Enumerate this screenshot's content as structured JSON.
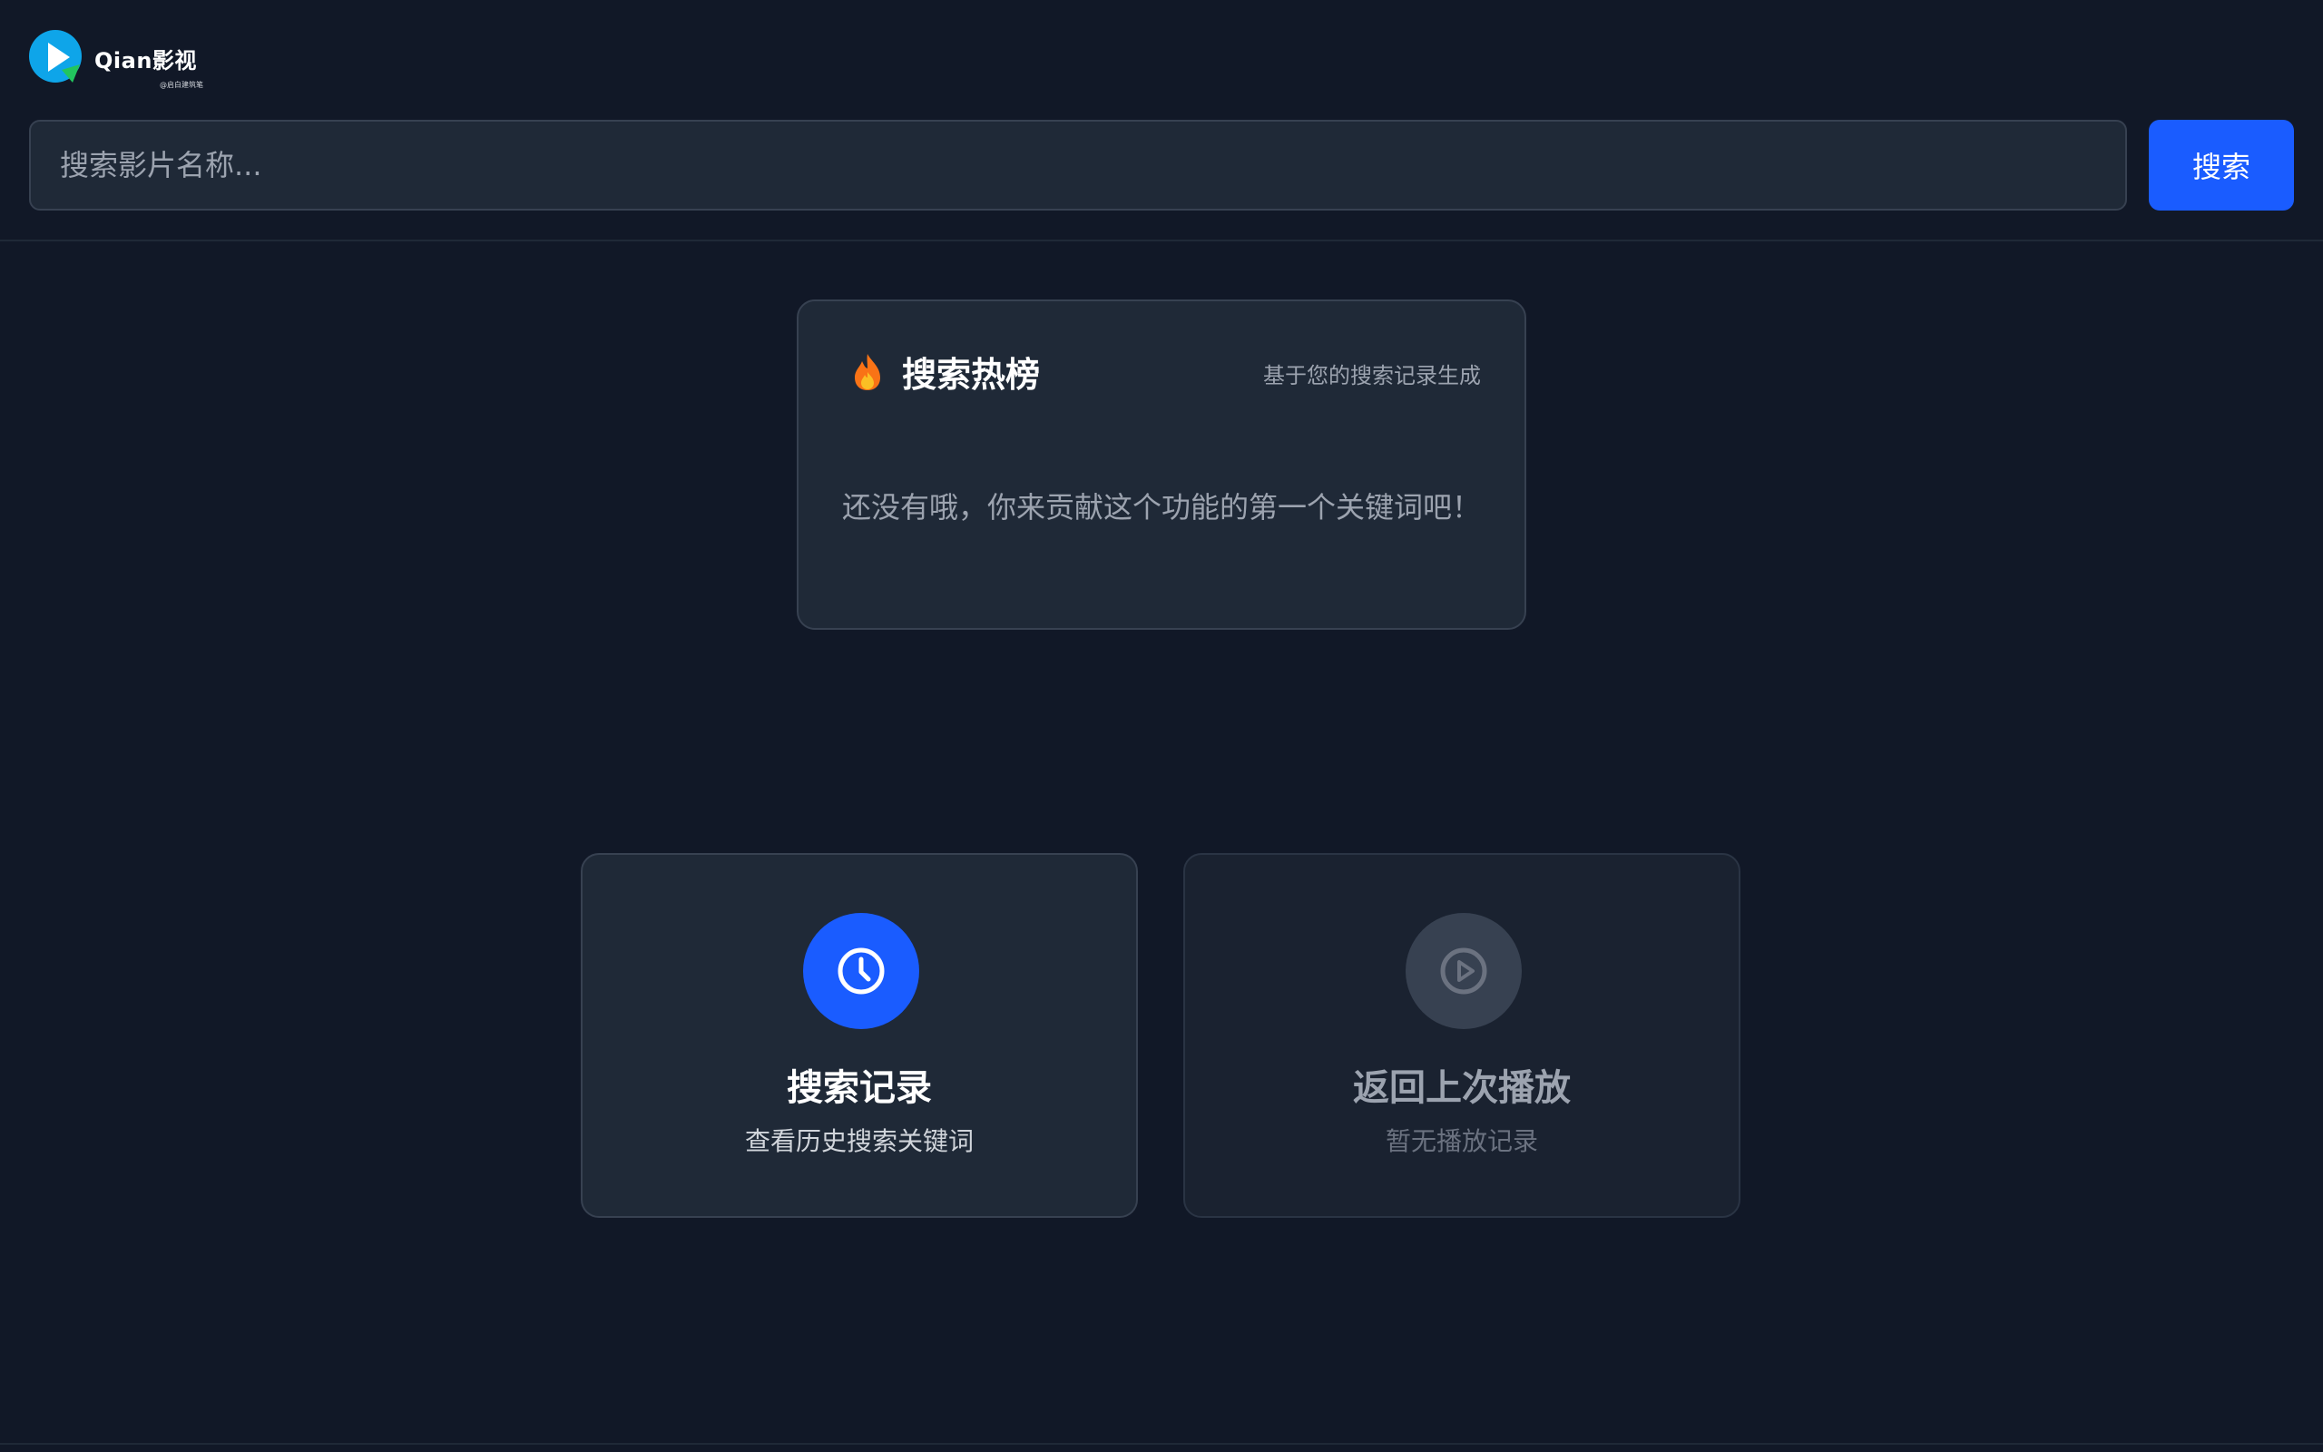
{
  "header": {
    "logo_text": "Qian影视",
    "logo_sub": "@启白建筑笔",
    "search_placeholder": "搜索影片名称...",
    "search_button": "搜索"
  },
  "hot_search": {
    "icon": "fire-icon",
    "title": "搜索热榜",
    "note": "基于您的搜索记录生成",
    "empty_message": "还没有哦，你来贡献这个功能的第一个关键词吧！"
  },
  "actions": {
    "history": {
      "icon": "clock-icon",
      "title": "搜索记录",
      "subtitle": "查看历史搜索关键词"
    },
    "resume": {
      "icon": "play-circle-icon",
      "title": "返回上次播放",
      "subtitle": "暂无播放记录"
    }
  },
  "colors": {
    "background": "#111827",
    "card": "#1f2937",
    "accent": "#1a5cff",
    "muted": "#9ca3af"
  }
}
